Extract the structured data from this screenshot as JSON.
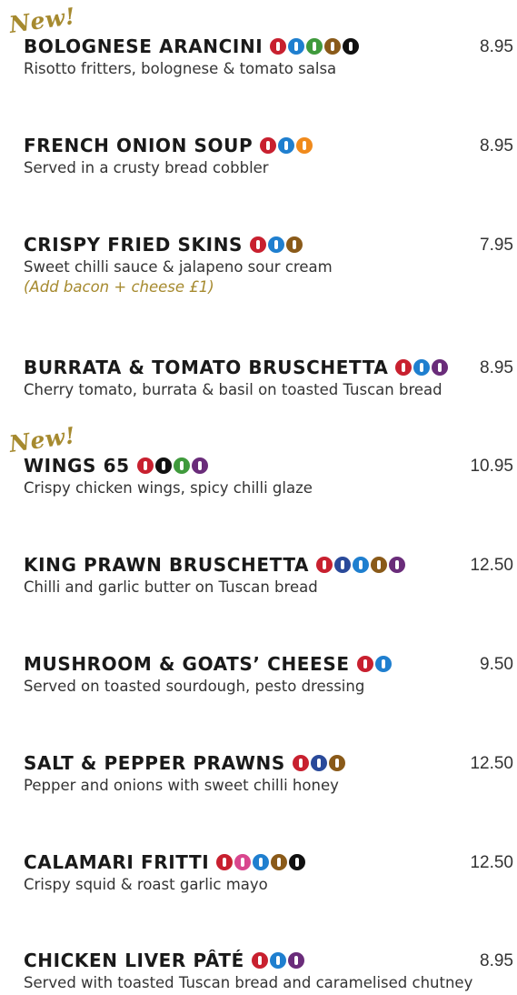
{
  "colors": {
    "red": "#c8202f",
    "blue": "#1f7fcf",
    "green": "#3f9a3c",
    "brown": "#8a5a19",
    "black": "#111111",
    "orange": "#f08a1c",
    "purple": "#6a2c7a",
    "navy": "#2a4a9a",
    "pink": "#d9478e",
    "gold": "#a68a2f"
  },
  "items": [
    {
      "new": "New!",
      "title": "BOLOGNESE ARANCINI",
      "desc": "Risotto fritters, bolognese & tomato salsa",
      "price": "8.95",
      "icons": [
        "red",
        "blue",
        "green",
        "brown",
        "black"
      ]
    },
    {
      "title": "FRENCH ONION SOUP",
      "desc": "Served in a crusty bread cobbler",
      "price": "8.95",
      "icons": [
        "red",
        "blue",
        "orange"
      ]
    },
    {
      "title": "CRISPY FRIED SKINS",
      "desc": "Sweet chilli sauce & jalapeno sour cream",
      "price": "7.95",
      "note": "(Add bacon + cheese £1)",
      "icons": [
        "red",
        "blue",
        "brown"
      ]
    },
    {
      "title": "BURRATA & TOMATO BRUSCHETTA",
      "desc": "Cherry tomato, burrata & basil on toasted Tuscan bread",
      "price": "8.95",
      "icons": [
        "red",
        "blue",
        "purple"
      ]
    },
    {
      "new": "New!",
      "title": "WINGS 65",
      "desc": "Crispy chicken wings, spicy chilli glaze",
      "price": "10.95",
      "icons": [
        "red",
        "black",
        "green",
        "purple"
      ]
    },
    {
      "title": "KING PRAWN BRUSCHETTA",
      "desc": "Chilli and garlic butter on Tuscan bread",
      "price": "12.50",
      "icons": [
        "red",
        "navy",
        "blue",
        "brown",
        "purple"
      ]
    },
    {
      "title": "MUSHROOM & GOATS’ CHEESE",
      "desc": "Served on toasted sourdough, pesto dressing",
      "price": "9.50",
      "icons": [
        "red",
        "blue"
      ]
    },
    {
      "title": "SALT & PEPPER PRAWNS",
      "desc": "Pepper and onions with sweet chilli honey",
      "price": "12.50",
      "icons": [
        "red",
        "navy",
        "brown"
      ]
    },
    {
      "title": "CALAMARI FRITTI",
      "desc": "Crispy squid & roast garlic mayo",
      "price": "12.50",
      "icons": [
        "red",
        "pink",
        "blue",
        "brown",
        "black"
      ]
    },
    {
      "title": "CHICKEN LIVER PÂTÉ",
      "desc": "Served with toasted Tuscan bread and caramelised chutney",
      "price": "8.95",
      "icons": [
        "red",
        "blue",
        "purple"
      ]
    }
  ]
}
